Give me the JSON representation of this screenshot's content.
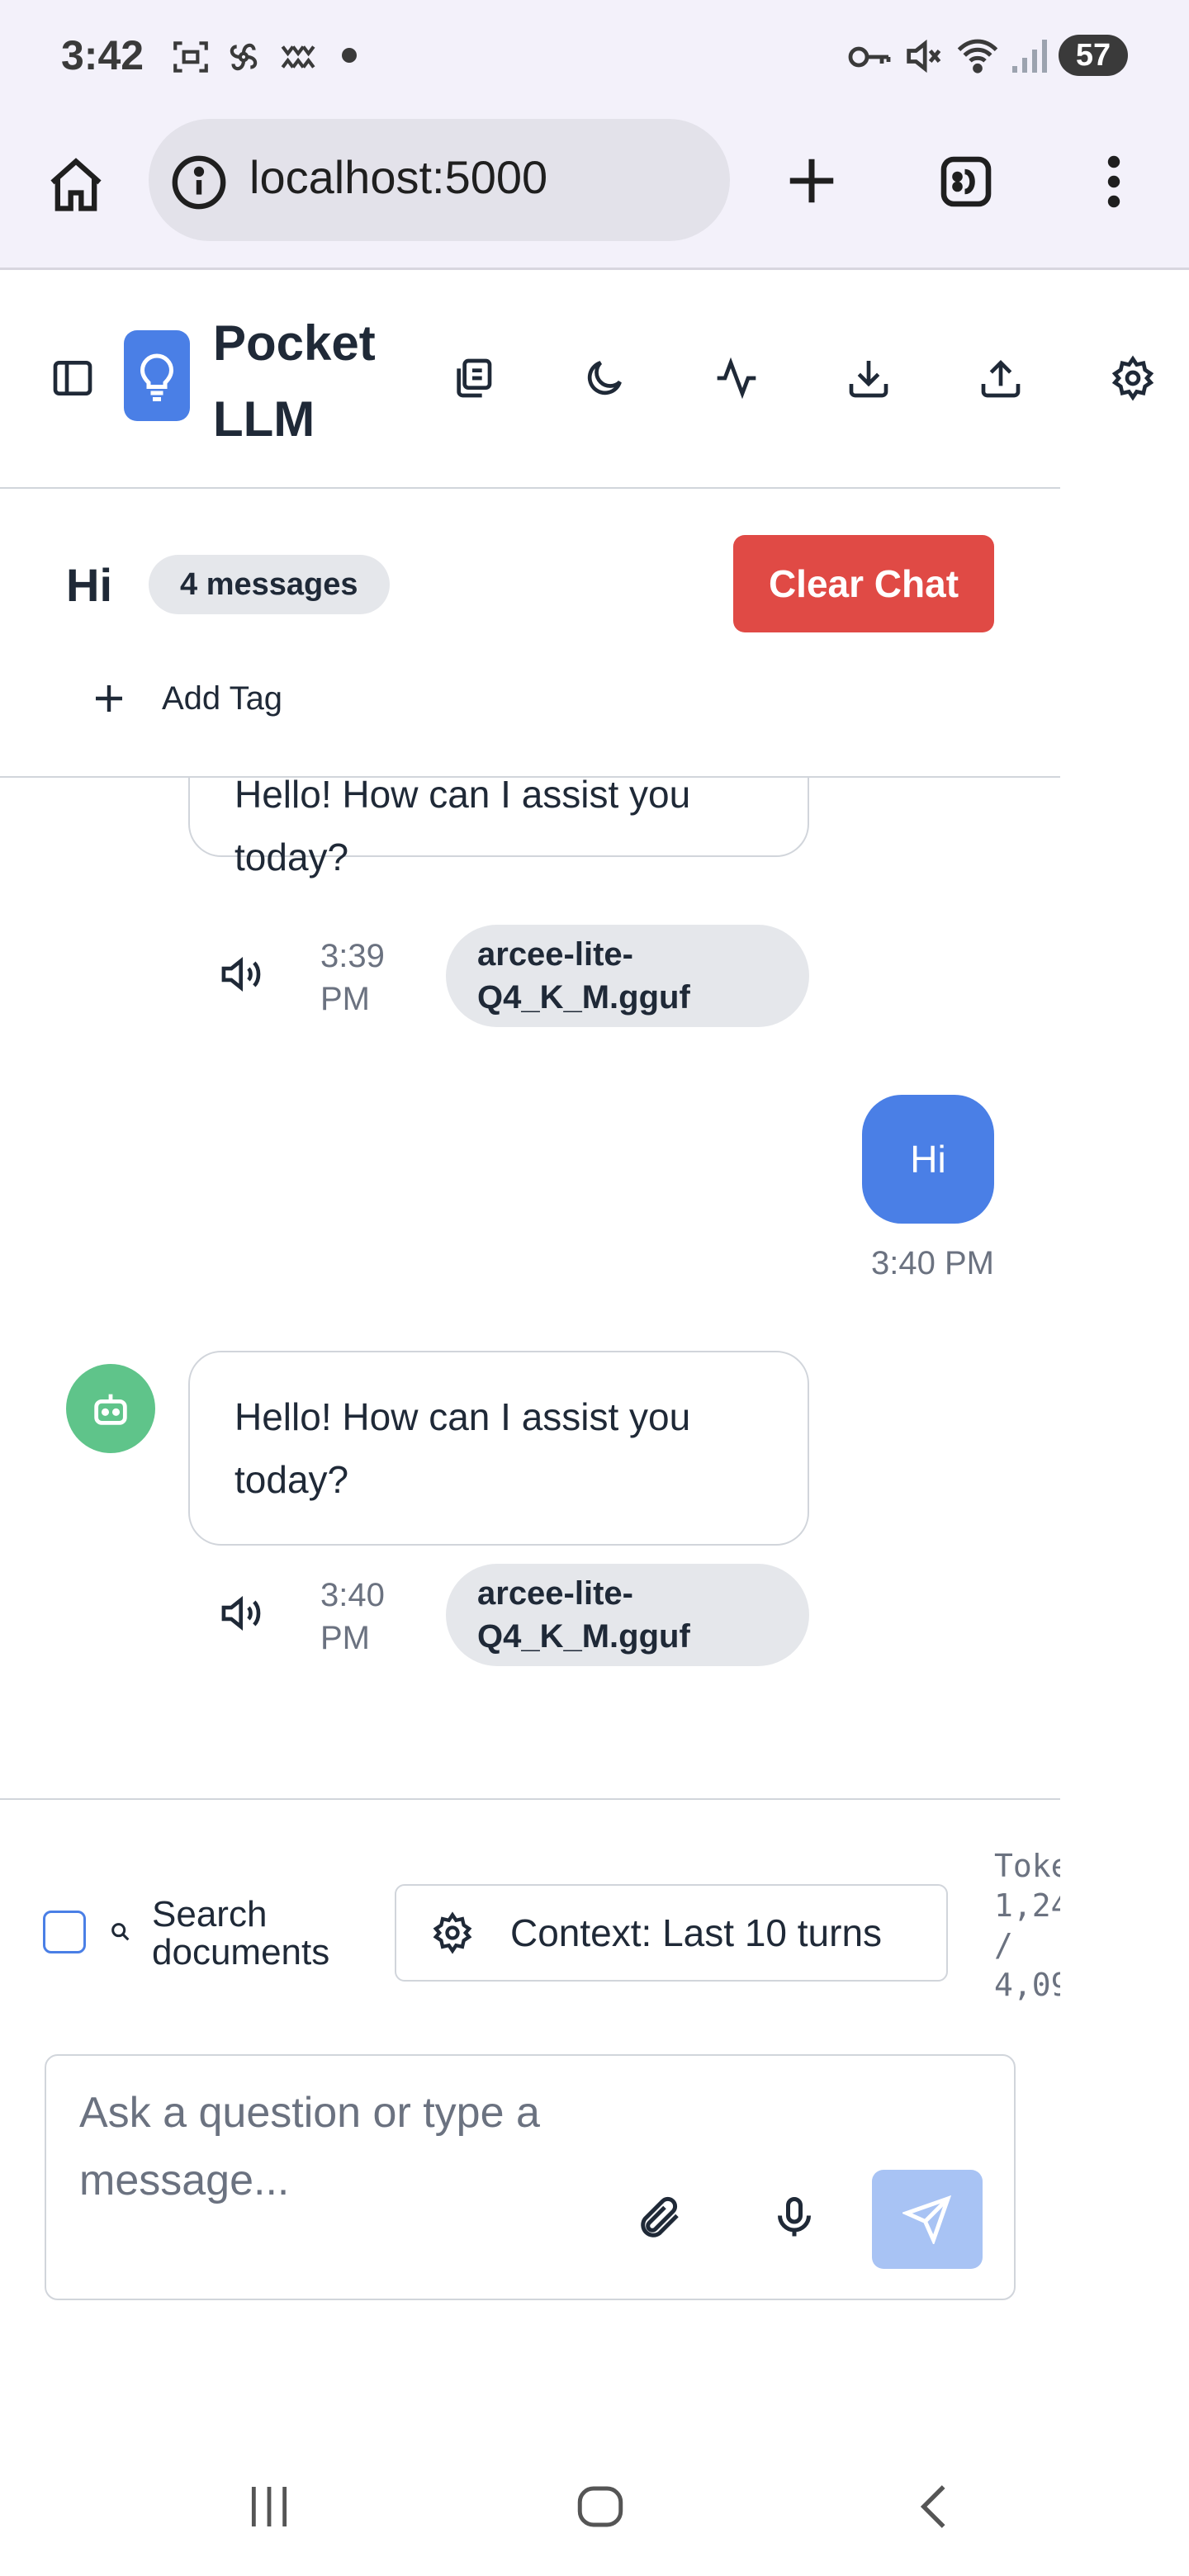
{
  "status_bar": {
    "time": "3:42",
    "battery": "57"
  },
  "browser": {
    "url": "localhost:5000"
  },
  "app": {
    "title": "Pocket LLM"
  },
  "chat": {
    "title": "Hi",
    "message_count": "4 messages",
    "clear_label": "Clear Chat",
    "add_tag_label": "Add Tag"
  },
  "messages": [
    {
      "role": "assistant",
      "text": "Hello! How can I assist you today?",
      "time": "3:39 PM",
      "model": "arcee-lite-Q4_K_M.gguf"
    },
    {
      "role": "user",
      "text": "Hi",
      "time": "3:40 PM"
    },
    {
      "role": "assistant",
      "text": "Hello! How can I assist you today?",
      "time": "3:40 PM",
      "model": "arcee-lite-Q4_K_M.gguf"
    }
  ],
  "controls": {
    "search_label": "Search documents",
    "context_label": "Context: Last 10 turns",
    "token_label": "Tokens:",
    "token_used": "1,24",
    "token_sep": "/",
    "token_max": "4,09"
  },
  "composer": {
    "placeholder": "Ask a question or type a message..."
  },
  "colors": {
    "accent": "#4a7fe6",
    "danger": "#e04a45",
    "avatar": "#5fc48a"
  }
}
